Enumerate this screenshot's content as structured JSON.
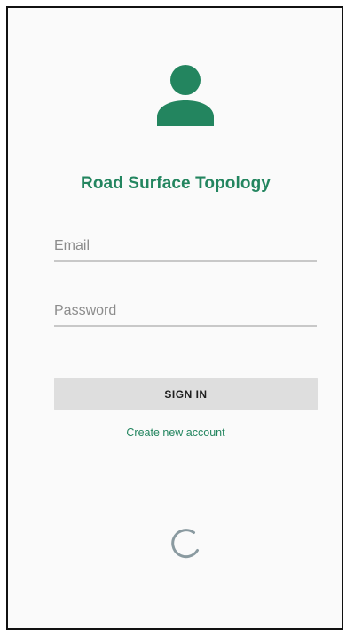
{
  "app": {
    "title": "Road Surface Topology"
  },
  "icons": {
    "avatar": "person-icon",
    "spinner": "loading-spinner-icon"
  },
  "colors": {
    "accent": "#23855f",
    "button_bg": "#dedede",
    "background": "#fafafa",
    "underline": "#c8c8c8",
    "spinner": "#8a9aa0"
  },
  "form": {
    "email_placeholder": "Email",
    "email_value": "",
    "password_placeholder": "Password",
    "password_value": "",
    "signin_label": "SIGN IN",
    "create_account_label": "Create new account"
  }
}
